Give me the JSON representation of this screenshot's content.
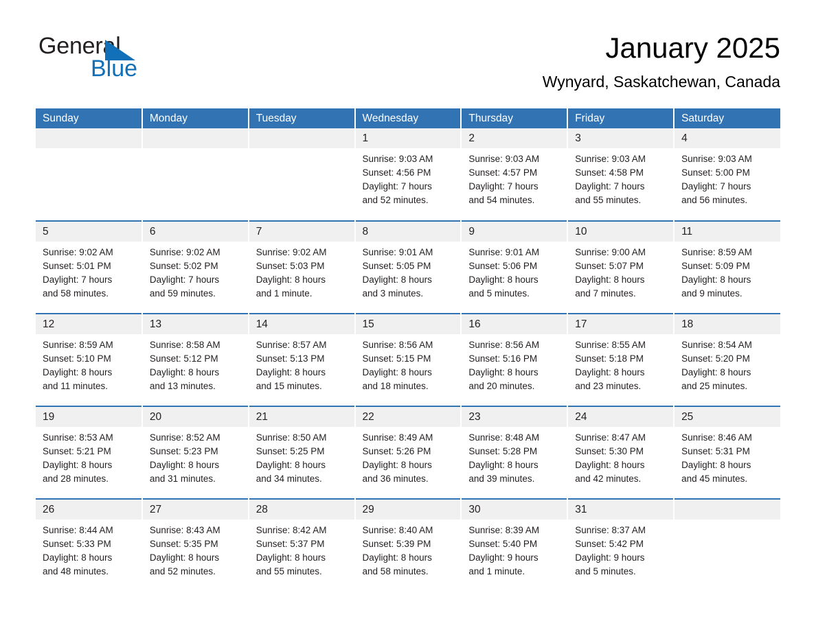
{
  "brand": {
    "line1": "General",
    "line2": "Blue",
    "accent_color": "#1170b8",
    "triangle_icon": "triangle-icon"
  },
  "header": {
    "title": "January 2025",
    "subtitle": "Wynyard, Saskatchewan, Canada"
  },
  "theme": {
    "header_blue": "#3273b4",
    "daynum_band": "#f0f0f0",
    "text": "#231f20"
  },
  "calendar": {
    "weekdays": [
      "Sunday",
      "Monday",
      "Tuesday",
      "Wednesday",
      "Thursday",
      "Friday",
      "Saturday"
    ],
    "weeks": [
      [
        {
          "day": "",
          "blank": true
        },
        {
          "day": "",
          "blank": true
        },
        {
          "day": "",
          "blank": true
        },
        {
          "day": "1",
          "sunrise": "Sunrise: 9:03 AM",
          "sunset": "Sunset: 4:56 PM",
          "daylight_1": "Daylight: 7 hours",
          "daylight_2": "and 52 minutes."
        },
        {
          "day": "2",
          "sunrise": "Sunrise: 9:03 AM",
          "sunset": "Sunset: 4:57 PM",
          "daylight_1": "Daylight: 7 hours",
          "daylight_2": "and 54 minutes."
        },
        {
          "day": "3",
          "sunrise": "Sunrise: 9:03 AM",
          "sunset": "Sunset: 4:58 PM",
          "daylight_1": "Daylight: 7 hours",
          "daylight_2": "and 55 minutes."
        },
        {
          "day": "4",
          "sunrise": "Sunrise: 9:03 AM",
          "sunset": "Sunset: 5:00 PM",
          "daylight_1": "Daylight: 7 hours",
          "daylight_2": "and 56 minutes."
        }
      ],
      [
        {
          "day": "5",
          "sunrise": "Sunrise: 9:02 AM",
          "sunset": "Sunset: 5:01 PM",
          "daylight_1": "Daylight: 7 hours",
          "daylight_2": "and 58 minutes."
        },
        {
          "day": "6",
          "sunrise": "Sunrise: 9:02 AM",
          "sunset": "Sunset: 5:02 PM",
          "daylight_1": "Daylight: 7 hours",
          "daylight_2": "and 59 minutes."
        },
        {
          "day": "7",
          "sunrise": "Sunrise: 9:02 AM",
          "sunset": "Sunset: 5:03 PM",
          "daylight_1": "Daylight: 8 hours",
          "daylight_2": "and 1 minute."
        },
        {
          "day": "8",
          "sunrise": "Sunrise: 9:01 AM",
          "sunset": "Sunset: 5:05 PM",
          "daylight_1": "Daylight: 8 hours",
          "daylight_2": "and 3 minutes."
        },
        {
          "day": "9",
          "sunrise": "Sunrise: 9:01 AM",
          "sunset": "Sunset: 5:06 PM",
          "daylight_1": "Daylight: 8 hours",
          "daylight_2": "and 5 minutes."
        },
        {
          "day": "10",
          "sunrise": "Sunrise: 9:00 AM",
          "sunset": "Sunset: 5:07 PM",
          "daylight_1": "Daylight: 8 hours",
          "daylight_2": "and 7 minutes."
        },
        {
          "day": "11",
          "sunrise": "Sunrise: 8:59 AM",
          "sunset": "Sunset: 5:09 PM",
          "daylight_1": "Daylight: 8 hours",
          "daylight_2": "and 9 minutes."
        }
      ],
      [
        {
          "day": "12",
          "sunrise": "Sunrise: 8:59 AM",
          "sunset": "Sunset: 5:10 PM",
          "daylight_1": "Daylight: 8 hours",
          "daylight_2": "and 11 minutes."
        },
        {
          "day": "13",
          "sunrise": "Sunrise: 8:58 AM",
          "sunset": "Sunset: 5:12 PM",
          "daylight_1": "Daylight: 8 hours",
          "daylight_2": "and 13 minutes."
        },
        {
          "day": "14",
          "sunrise": "Sunrise: 8:57 AM",
          "sunset": "Sunset: 5:13 PM",
          "daylight_1": "Daylight: 8 hours",
          "daylight_2": "and 15 minutes."
        },
        {
          "day": "15",
          "sunrise": "Sunrise: 8:56 AM",
          "sunset": "Sunset: 5:15 PM",
          "daylight_1": "Daylight: 8 hours",
          "daylight_2": "and 18 minutes."
        },
        {
          "day": "16",
          "sunrise": "Sunrise: 8:56 AM",
          "sunset": "Sunset: 5:16 PM",
          "daylight_1": "Daylight: 8 hours",
          "daylight_2": "and 20 minutes."
        },
        {
          "day": "17",
          "sunrise": "Sunrise: 8:55 AM",
          "sunset": "Sunset: 5:18 PM",
          "daylight_1": "Daylight: 8 hours",
          "daylight_2": "and 23 minutes."
        },
        {
          "day": "18",
          "sunrise": "Sunrise: 8:54 AM",
          "sunset": "Sunset: 5:20 PM",
          "daylight_1": "Daylight: 8 hours",
          "daylight_2": "and 25 minutes."
        }
      ],
      [
        {
          "day": "19",
          "sunrise": "Sunrise: 8:53 AM",
          "sunset": "Sunset: 5:21 PM",
          "daylight_1": "Daylight: 8 hours",
          "daylight_2": "and 28 minutes."
        },
        {
          "day": "20",
          "sunrise": "Sunrise: 8:52 AM",
          "sunset": "Sunset: 5:23 PM",
          "daylight_1": "Daylight: 8 hours",
          "daylight_2": "and 31 minutes."
        },
        {
          "day": "21",
          "sunrise": "Sunrise: 8:50 AM",
          "sunset": "Sunset: 5:25 PM",
          "daylight_1": "Daylight: 8 hours",
          "daylight_2": "and 34 minutes."
        },
        {
          "day": "22",
          "sunrise": "Sunrise: 8:49 AM",
          "sunset": "Sunset: 5:26 PM",
          "daylight_1": "Daylight: 8 hours",
          "daylight_2": "and 36 minutes."
        },
        {
          "day": "23",
          "sunrise": "Sunrise: 8:48 AM",
          "sunset": "Sunset: 5:28 PM",
          "daylight_1": "Daylight: 8 hours",
          "daylight_2": "and 39 minutes."
        },
        {
          "day": "24",
          "sunrise": "Sunrise: 8:47 AM",
          "sunset": "Sunset: 5:30 PM",
          "daylight_1": "Daylight: 8 hours",
          "daylight_2": "and 42 minutes."
        },
        {
          "day": "25",
          "sunrise": "Sunrise: 8:46 AM",
          "sunset": "Sunset: 5:31 PM",
          "daylight_1": "Daylight: 8 hours",
          "daylight_2": "and 45 minutes."
        }
      ],
      [
        {
          "day": "26",
          "sunrise": "Sunrise: 8:44 AM",
          "sunset": "Sunset: 5:33 PM",
          "daylight_1": "Daylight: 8 hours",
          "daylight_2": "and 48 minutes."
        },
        {
          "day": "27",
          "sunrise": "Sunrise: 8:43 AM",
          "sunset": "Sunset: 5:35 PM",
          "daylight_1": "Daylight: 8 hours",
          "daylight_2": "and 52 minutes."
        },
        {
          "day": "28",
          "sunrise": "Sunrise: 8:42 AM",
          "sunset": "Sunset: 5:37 PM",
          "daylight_1": "Daylight: 8 hours",
          "daylight_2": "and 55 minutes."
        },
        {
          "day": "29",
          "sunrise": "Sunrise: 8:40 AM",
          "sunset": "Sunset: 5:39 PM",
          "daylight_1": "Daylight: 8 hours",
          "daylight_2": "and 58 minutes."
        },
        {
          "day": "30",
          "sunrise": "Sunrise: 8:39 AM",
          "sunset": "Sunset: 5:40 PM",
          "daylight_1": "Daylight: 9 hours",
          "daylight_2": "and 1 minute."
        },
        {
          "day": "31",
          "sunrise": "Sunrise: 8:37 AM",
          "sunset": "Sunset: 5:42 PM",
          "daylight_1": "Daylight: 9 hours",
          "daylight_2": "and 5 minutes."
        },
        {
          "day": "",
          "blank": true
        }
      ]
    ]
  }
}
